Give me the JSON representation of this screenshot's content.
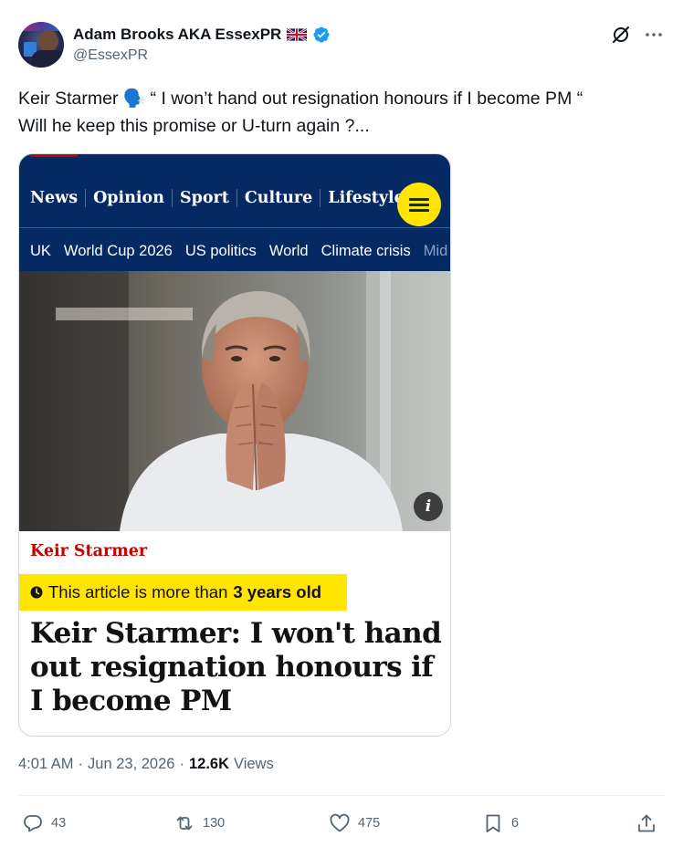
{
  "author": {
    "display_name": "Adam Brooks AKA EssexPR",
    "handle": "@EssexPR",
    "flag_icon": "uk-flag-icon",
    "verified_icon": "verified-badge-icon",
    "verified_color": "#1d9bf0"
  },
  "header_actions": {
    "grok_icon": "grok-icon",
    "more_icon": "more-options-icon"
  },
  "tweet": {
    "line1": "Keir Starmer 🗣️  “ I won’t hand out resignation honours if I become PM “",
    "line2": "Will he keep this promise or U-turn again ?..."
  },
  "card": {
    "nav": {
      "pillars": [
        "News",
        "Opinion",
        "Sport",
        "Culture",
        "Lifestyle"
      ],
      "subnav": [
        "UK",
        "World Cup 2026",
        "US politics",
        "World",
        "Climate crisis",
        "Mid"
      ],
      "menu_icon": "hamburger-menu-icon"
    },
    "info_label": "i",
    "kicker": "Keir Starmer",
    "age_badge": {
      "prefix": "This article is more than",
      "emphasis": "3 years old"
    },
    "headline": "Keir Starmer: I won't hand out resignation honours if I become PM",
    "colors": {
      "nav_bg": "#052962",
      "accent_yellow": "#ffe500",
      "kicker_red": "#c70000"
    }
  },
  "meta": {
    "time": "4:01 AM",
    "separator": "·",
    "date": "Jun 23, 2026",
    "views_count": "12.6K",
    "views_label": "Views"
  },
  "actions": {
    "replies": "43",
    "reposts": "130",
    "likes": "475",
    "bookmarks": "6"
  }
}
